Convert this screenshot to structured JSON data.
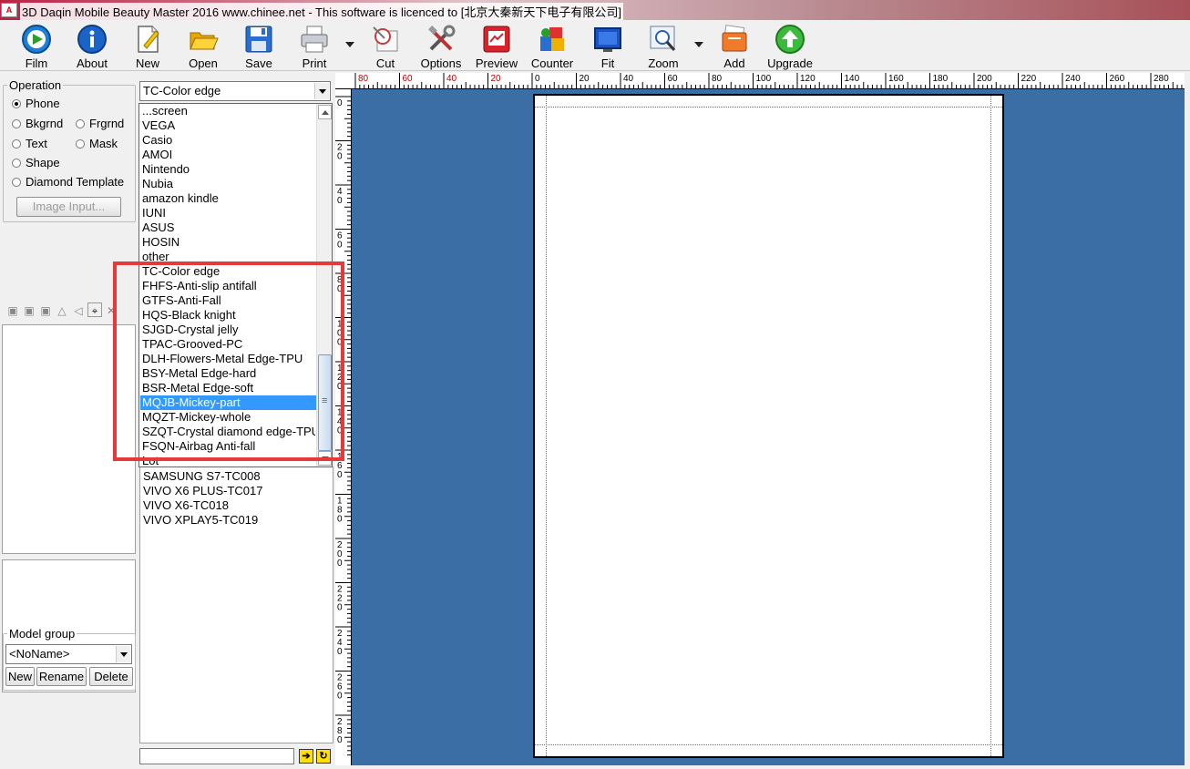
{
  "window": {
    "title": "3D Daqin Mobile Beauty Master 2016 www.chinee.net - This software is licenced to [北京大秦新天下电子有限公司]"
  },
  "toolbar": [
    {
      "label": "Film",
      "icon": "film-icon"
    },
    {
      "label": "About",
      "icon": "info-icon"
    },
    {
      "label": "New",
      "icon": "new-document-icon"
    },
    {
      "label": "Open",
      "icon": "folder-open-icon"
    },
    {
      "label": "Save",
      "icon": "floppy-disk-icon"
    },
    {
      "label": "Print",
      "icon": "printer-icon"
    },
    {
      "label": "Cut",
      "icon": "cut-icon"
    },
    {
      "label": "Options",
      "icon": "tools-icon"
    },
    {
      "label": "Preview",
      "icon": "preview-icon"
    },
    {
      "label": "Counter",
      "icon": "counter-icon"
    },
    {
      "label": "Fit",
      "icon": "fit-screen-icon"
    },
    {
      "label": "Zoom",
      "icon": "zoom-icon"
    },
    {
      "label": "Add",
      "icon": "add-icon"
    },
    {
      "label": "Upgrade",
      "icon": "upgrade-arrow-icon"
    }
  ],
  "operation": {
    "legend": "Operation",
    "options": [
      "Phone",
      "Bkgrnd",
      "Frgrnd",
      "Text",
      "Mask",
      "Shape",
      "Diamond Template"
    ],
    "selected": "Phone",
    "image_input": "Image Input..."
  },
  "model_group": {
    "legend": "Model group",
    "selected": "<NoName>",
    "new": "New",
    "rename": "Rename",
    "delete": "Delete"
  },
  "brand_combo": {
    "selected": "TC-Color edge"
  },
  "dropdown_items": [
    "...screen",
    "VEGA",
    "Casio",
    "AMOI",
    "Nintendo",
    "Nubia",
    "amazon kindle",
    "IUNI",
    "ASUS",
    "HOSIN",
    "other",
    "TC-Color edge",
    "FHFS-Anti-slip antifall",
    "GTFS-Anti-Fall",
    "HQS-Black knight",
    "SJGD-Crystal jelly",
    "TPAC-Grooved-PC",
    "DLH-Flowers-Metal Edge-TPU",
    "BSY-Metal Edge-hard",
    "BSR-Metal Edge-soft",
    "MQJB-Mickey-part",
    "MQZT-Mickey-whole",
    "SZQT-Crystal diamond edge-TPU",
    "FSQN-Airbag Anti-fall",
    "Lot"
  ],
  "dropdown_selected": "MQJB-Mickey-part",
  "model_list": [
    "SAMSUNG S7-TC008",
    "VIVO X6 PLUS-TC017",
    "VIVO X6-TC018",
    "VIVO XPLAY5-TC019"
  ],
  "hruler_labels": [
    "80",
    "60",
    "40",
    "20",
    "0",
    "20",
    "40",
    "60",
    "80",
    "100",
    "120",
    "140",
    "160",
    "180",
    "200",
    "220",
    "240",
    "260",
    "280"
  ],
  "vruler_labels": [
    "0",
    "20",
    "40",
    "60",
    "80",
    "100",
    "120",
    "140",
    "160",
    "180",
    "200",
    "220",
    "240",
    "260",
    "280"
  ],
  "colors": {
    "canvas_bg": "#3a6ea5",
    "selection": "#3399ff",
    "highlight_box": "#e63a3a"
  }
}
